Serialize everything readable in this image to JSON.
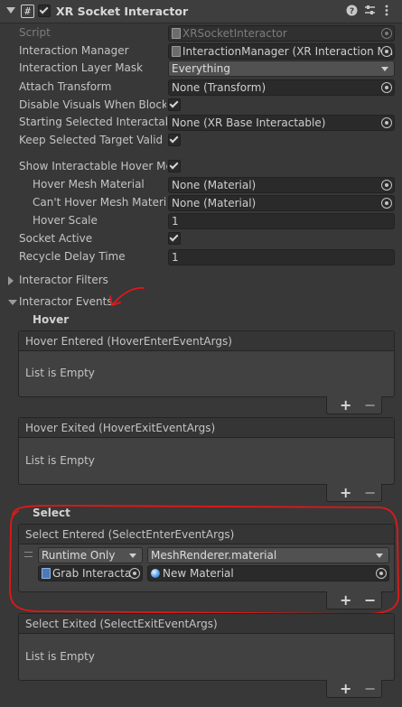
{
  "component": {
    "title": "XR Socket Interactor",
    "enabled": true
  },
  "properties": [
    {
      "label": "Script",
      "value": "XRSocketInteractor",
      "disabled": true,
      "icon": "script-icon",
      "target": true
    },
    {
      "label": "Interaction Manager",
      "value": "InteractionManager (XR Interaction Ma",
      "icon": "object-icon",
      "target": true
    },
    {
      "label": "Interaction Layer Mask",
      "value": "Everything",
      "dropdown": true
    },
    {
      "label": "Attach Transform",
      "value": "None (Transform)",
      "target": true
    },
    {
      "label": "Disable Visuals When Blocked",
      "checked": true
    },
    {
      "label": "Starting Selected Interactable",
      "value": "None (XR Base Interactable)",
      "target": true
    },
    {
      "label": "Keep Selected Target Valid",
      "checked": true
    },
    {
      "label": "Show Interactable Hover Meshes",
      "checked": true
    },
    {
      "label": "Hover Mesh Material",
      "value": "None (Material)",
      "target": true,
      "indent": true
    },
    {
      "label": "Can't Hover Mesh Material",
      "value": "None (Material)",
      "target": true,
      "indent": true
    },
    {
      "label": "Hover Scale",
      "value": "1",
      "indent": true
    },
    {
      "label": "Socket Active",
      "checked": true
    },
    {
      "label": "Recycle Delay Time",
      "value": "1"
    }
  ],
  "sections": {
    "interactor_filters": "Interactor Filters",
    "interactor_events": "Interactor Events"
  },
  "hover": {
    "header": "Hover",
    "entered": {
      "title": "Hover Entered (HoverEnterEventArgs)",
      "empty": "List is Empty"
    },
    "exited": {
      "title": "Hover Exited (HoverExitEventArgs)",
      "empty": "List is Empty"
    }
  },
  "select": {
    "header": "Select",
    "entered": {
      "title": "Select Entered (SelectEnterEventArgs)",
      "runtime": "Runtime Only",
      "function": "MeshRenderer.material",
      "object": "Grab Interactal",
      "argument": "New Material"
    },
    "exited": {
      "title": "Select Exited (SelectExitEventArgs)",
      "empty": "List is Empty"
    }
  },
  "buttons": {
    "plus": "+",
    "minus": "−"
  },
  "colors": {
    "annotation_red": "#e01818"
  }
}
